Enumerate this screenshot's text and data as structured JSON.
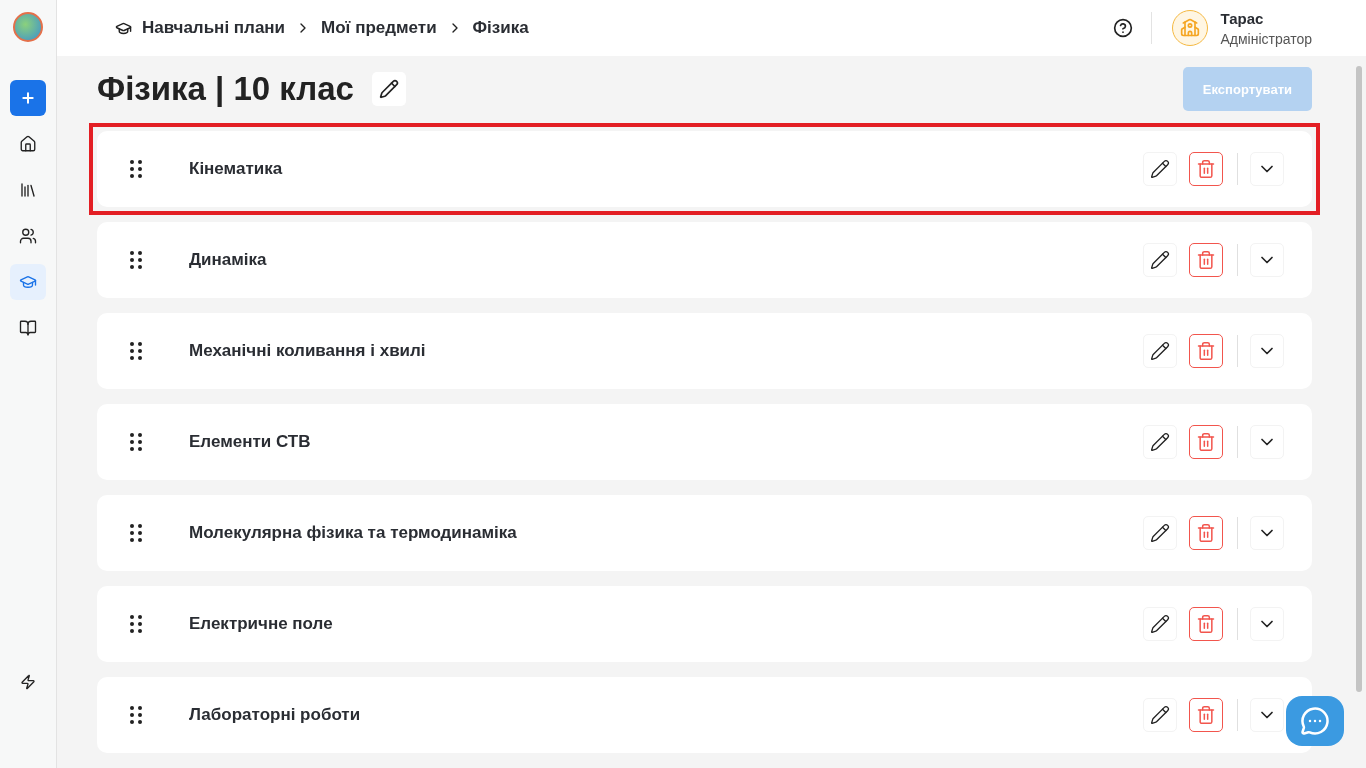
{
  "sidebar": {
    "items": [
      {
        "kind": "home",
        "selected": false
      },
      {
        "kind": "library",
        "selected": false
      },
      {
        "kind": "users",
        "selected": false
      },
      {
        "kind": "courses",
        "selected": true
      },
      {
        "kind": "journal",
        "selected": false
      }
    ]
  },
  "breadcrumbs": [
    "Навчальні плани",
    "Мої предмети",
    "Фізика"
  ],
  "user": {
    "name": "Тарас",
    "role": "Адміністратор"
  },
  "page": {
    "title": "Фізика | 10 клас"
  },
  "export_button": {
    "label": "Експортувати",
    "disabled": true
  },
  "topics": [
    {
      "name": "Кінематика",
      "highlighted": true
    },
    {
      "name": "Динаміка",
      "highlighted": false
    },
    {
      "name": "Механічні коливання і хвилі",
      "highlighted": false
    },
    {
      "name": "Елементи СТВ",
      "highlighted": false
    },
    {
      "name": "Молекулярна фізика та термодинаміка",
      "highlighted": false
    },
    {
      "name": "Електричне поле",
      "highlighted": false
    },
    {
      "name": "Лабораторні роботи",
      "highlighted": false
    }
  ]
}
